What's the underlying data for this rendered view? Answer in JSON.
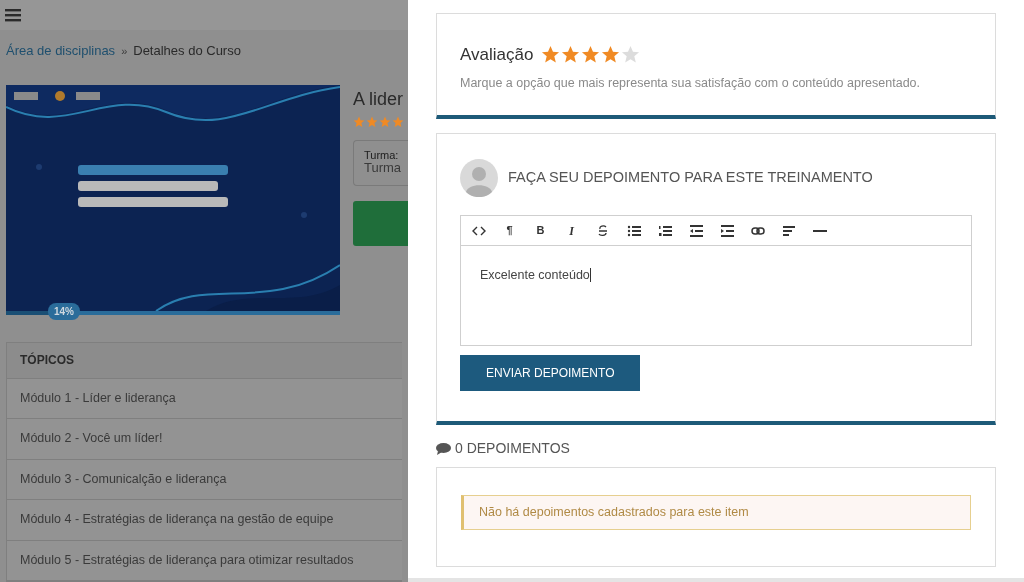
{
  "breadcrumb": {
    "link": "Área de disciplinas",
    "separator": "»",
    "current": "Detalhes do Curso"
  },
  "course": {
    "title": "A lider",
    "stars": 4,
    "progress": {
      "label": "14%",
      "level": 0.14
    },
    "class_label": "Turma:",
    "class_value": "Turma"
  },
  "topics": {
    "header": "TÓPICOS",
    "items": [
      {
        "label": "Módulo 1 - Líder e liderança"
      },
      {
        "label": "Módulo 2 - Você um líder!"
      },
      {
        "label": "Módulo 3 - Comunicalção e liderança"
      },
      {
        "label": "Módulo 4 - Estratégias de liderança na gestão de equipe"
      },
      {
        "label": "Módulo 5 - Estratégias de liderança para otimizar resultados"
      }
    ]
  },
  "rating": {
    "title": "Avaliação",
    "stars": 4,
    "hint": "Marque a opção que mais representa sua satisfação com o conteúdo apresentado."
  },
  "testimonial_form": {
    "title": "FAÇA SEU DEPOIMENTO PARA ESTE TREINAMENTO",
    "toolbar": [
      {
        "kind": "code"
      },
      {
        "kind": "glyph",
        "text": "¶"
      },
      {
        "kind": "glyph",
        "text": "B"
      },
      {
        "kind": "italic",
        "text": "I"
      },
      {
        "kind": "strike"
      },
      {
        "kind": "ul"
      },
      {
        "kind": "ol"
      },
      {
        "kind": "outdent"
      },
      {
        "kind": "indent"
      },
      {
        "kind": "link"
      },
      {
        "kind": "align"
      },
      {
        "kind": "rule"
      }
    ],
    "value": "Excelente conteúdo",
    "submit": "ENVIAR DEPOIMENTO"
  },
  "testimonials": {
    "count_label": "0 DEPOIMENTOS",
    "empty_message": "Não há depoimentos cadastrados para este item"
  }
}
